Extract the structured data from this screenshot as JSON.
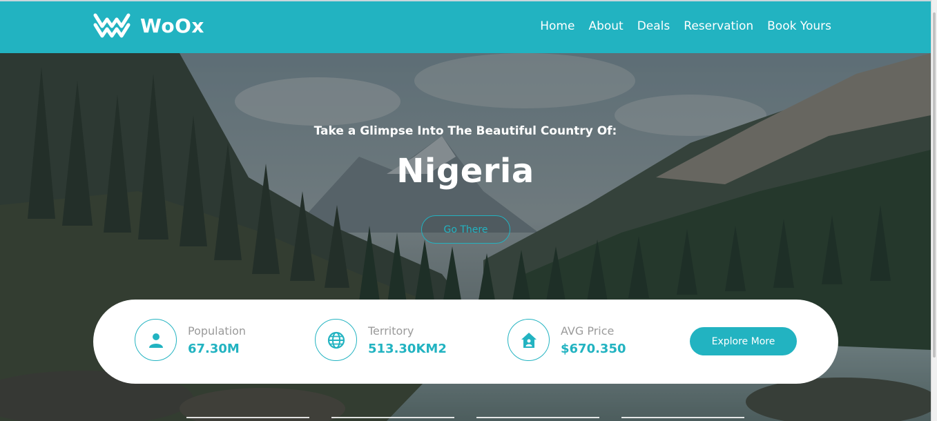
{
  "brand": {
    "name": "WoOx",
    "accent": "#22b3c1"
  },
  "nav": {
    "items": [
      {
        "label": "Home"
      },
      {
        "label": "About"
      },
      {
        "label": "Deals"
      },
      {
        "label": "Reservation"
      },
      {
        "label": "Book Yours"
      }
    ]
  },
  "hero": {
    "subtitle": "Take a Glimpse Into The Beautiful Country Of:",
    "title": "Nigeria",
    "cta_label": "Go There",
    "background": "forest-mountain-river-photo"
  },
  "stats": {
    "population": {
      "label": "Population",
      "value": "67.30M",
      "icon": "user-icon"
    },
    "territory": {
      "label": "Territory",
      "value": "513.30KM2",
      "icon": "globe-icon"
    },
    "avg_price": {
      "label": "AVG Price",
      "value": "$670.350",
      "icon": "home-icon"
    },
    "explore_label": "Explore More"
  },
  "slider": {
    "count": 4
  }
}
